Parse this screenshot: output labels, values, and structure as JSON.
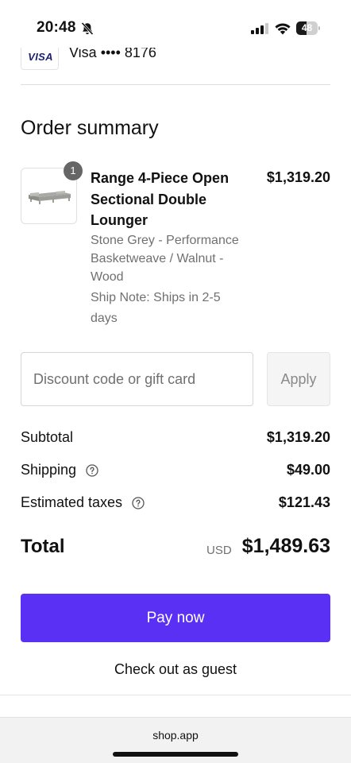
{
  "status_bar": {
    "time": "20:48",
    "battery": "48",
    "battery_level": 0.48,
    "icons": [
      "bell-slash-icon",
      "cellular-signal-icon",
      "wifi-icon",
      "battery-icon"
    ]
  },
  "payment": {
    "brand": "VISA",
    "card_label": "Visa •••• 8176"
  },
  "order_summary": {
    "title": "Order summary",
    "item": {
      "quantity": "1",
      "name": "Range 4-Piece Open Sectional Double Lounger",
      "price": "$1,319.20",
      "variant": "Stone Grey - Performance Basketweave / Walnut - Wood",
      "ship_note": "Ship Note: Ships in 2-5 days",
      "thumbnail_icon": "sofa-thumbnail-icon"
    }
  },
  "discount": {
    "placeholder": "Discount code or gift card",
    "apply_label": "Apply"
  },
  "totals": {
    "subtotal_label": "Subtotal",
    "subtotal_value": "$1,319.20",
    "shipping_label": "Shipping",
    "shipping_value": "$49.00",
    "taxes_label": "Estimated taxes",
    "taxes_value": "$121.43",
    "total_label": "Total",
    "currency": "USD",
    "total_value": "$1,489.63"
  },
  "actions": {
    "pay_label": "Pay now",
    "guest_label": "Check out as guest"
  },
  "browser": {
    "url": "shop.app"
  },
  "colors": {
    "accent": "#5a31f4",
    "muted_text": "#707070"
  }
}
